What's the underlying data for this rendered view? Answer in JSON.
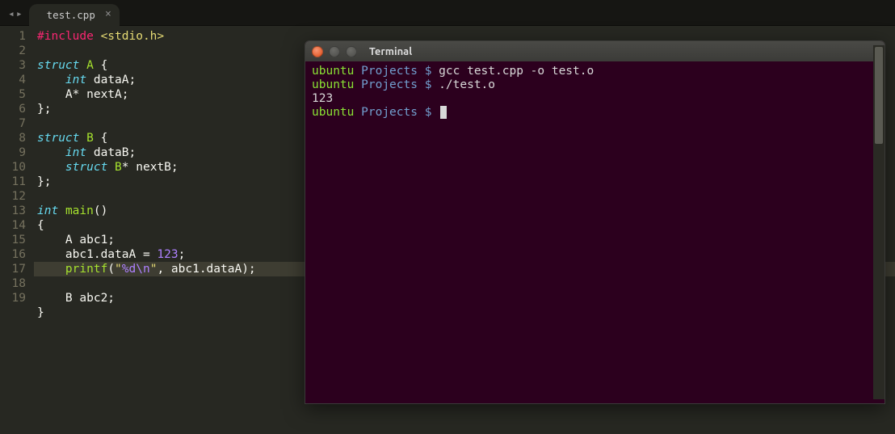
{
  "tabs": {
    "nav_left": "◂",
    "nav_right": "▸",
    "active": {
      "label": "test.cpp",
      "close": "×"
    }
  },
  "editor": {
    "highlighted_line": 17,
    "lines": [
      {
        "n": 1,
        "tokens": [
          [
            "pre",
            "#include"
          ],
          [
            "punc",
            " "
          ],
          [
            "str",
            "<stdio.h>"
          ]
        ]
      },
      {
        "n": 2,
        "tokens": []
      },
      {
        "n": 3,
        "tokens": [
          [
            "kw",
            "struct"
          ],
          [
            "punc",
            " "
          ],
          [
            "name",
            "A"
          ],
          [
            "punc",
            " {"
          ]
        ]
      },
      {
        "n": 4,
        "tokens": [
          [
            "punc",
            "    "
          ],
          [
            "type",
            "int"
          ],
          [
            "punc",
            " dataA;"
          ]
        ]
      },
      {
        "n": 5,
        "tokens": [
          [
            "punc",
            "    A"
          ],
          [
            "punc",
            "*"
          ],
          [
            "punc",
            " nextA;"
          ]
        ]
      },
      {
        "n": 6,
        "tokens": [
          [
            "punc",
            "};"
          ]
        ]
      },
      {
        "n": 7,
        "tokens": []
      },
      {
        "n": 8,
        "tokens": [
          [
            "kw",
            "struct"
          ],
          [
            "punc",
            " "
          ],
          [
            "name",
            "B"
          ],
          [
            "punc",
            " {"
          ]
        ]
      },
      {
        "n": 9,
        "tokens": [
          [
            "punc",
            "    "
          ],
          [
            "type",
            "int"
          ],
          [
            "punc",
            " dataB;"
          ]
        ]
      },
      {
        "n": 10,
        "tokens": [
          [
            "punc",
            "    "
          ],
          [
            "kw",
            "struct"
          ],
          [
            "punc",
            " "
          ],
          [
            "name",
            "B"
          ],
          [
            "punc",
            "*"
          ],
          [
            "punc",
            " nextB;"
          ]
        ]
      },
      {
        "n": 11,
        "tokens": [
          [
            "punc",
            "};"
          ]
        ]
      },
      {
        "n": 12,
        "tokens": []
      },
      {
        "n": 13,
        "tokens": [
          [
            "type",
            "int"
          ],
          [
            "punc",
            " "
          ],
          [
            "func",
            "main"
          ],
          [
            "punc",
            "()"
          ]
        ]
      },
      {
        "n": 14,
        "tokens": [
          [
            "punc",
            "{"
          ]
        ]
      },
      {
        "n": 15,
        "tokens": [
          [
            "punc",
            "    A abc1;"
          ]
        ]
      },
      {
        "n": 16,
        "tokens": [
          [
            "punc",
            "    abc1.dataA "
          ],
          [
            "punc",
            "="
          ],
          [
            "punc",
            " "
          ],
          [
            "num",
            "123"
          ],
          [
            "punc",
            ";"
          ]
        ]
      },
      {
        "n": 17,
        "tokens": [
          [
            "punc",
            "    "
          ],
          [
            "func",
            "printf"
          ],
          [
            "punc",
            "("
          ],
          [
            "str",
            "\""
          ],
          [
            "esc",
            "%d\\n"
          ],
          [
            "str",
            "\""
          ],
          [
            "punc",
            ", abc1.dataA);"
          ]
        ]
      },
      {
        "n": 18,
        "tokens": [
          [
            "punc",
            "    B abc2;"
          ]
        ]
      },
      {
        "n": 19,
        "tokens": [
          [
            "punc",
            "}"
          ]
        ]
      }
    ]
  },
  "terminal": {
    "title": "Terminal",
    "lines": [
      {
        "host": "ubuntu",
        "path": "Projects",
        "prompt": "$",
        "cmd": "gcc test.cpp -o test.o"
      },
      {
        "host": "ubuntu",
        "path": "Projects",
        "prompt": "$",
        "cmd": "./test.o"
      },
      {
        "out": "123"
      },
      {
        "host": "ubuntu",
        "path": "Projects",
        "prompt": "$",
        "cmd": "",
        "cursor": true
      }
    ]
  }
}
